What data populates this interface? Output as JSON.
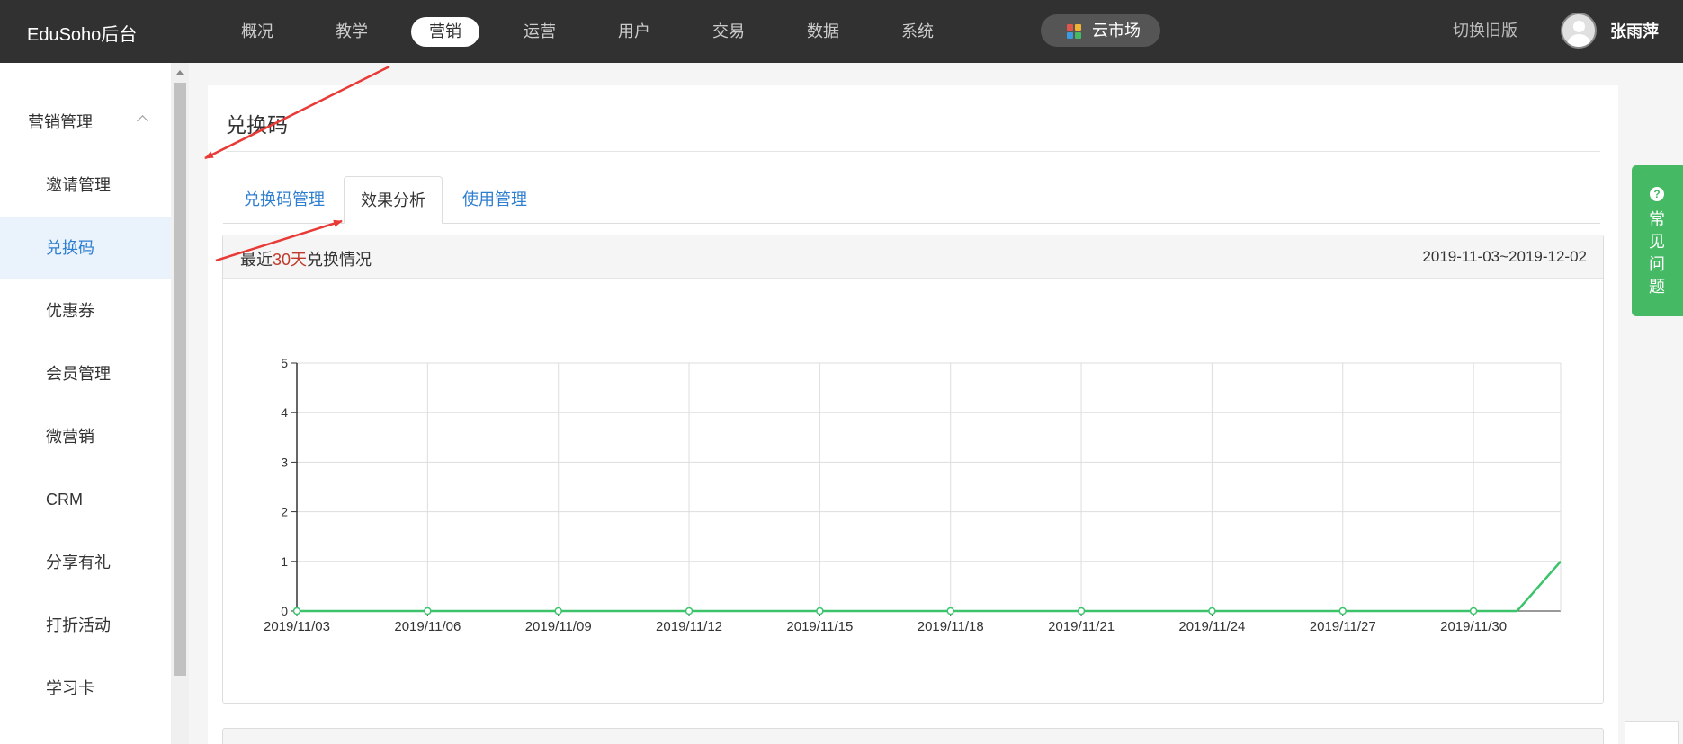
{
  "topnav": {
    "brand": "EduSoho后台",
    "items": [
      "概况",
      "教学",
      "营销",
      "运营",
      "用户",
      "交易",
      "数据",
      "系统"
    ],
    "active_index": 2,
    "cloud_market": "云市场",
    "switch_old": "切换旧版",
    "username": "张雨萍"
  },
  "sidebar": {
    "group_label": "营销管理",
    "items": [
      "邀请管理",
      "兑换码",
      "优惠券",
      "会员管理",
      "微营销",
      "CRM",
      "分享有礼",
      "打折活动",
      "学习卡"
    ],
    "active_index": 1
  },
  "main": {
    "title": "兑换码",
    "tabs": [
      "兑换码管理",
      "效果分析",
      "使用管理"
    ],
    "active_tab": 1,
    "card": {
      "title_prefix": "最近",
      "title_highlight": "30天",
      "title_suffix": "兑换情况",
      "date_range": "2019-11-03~2019-12-02"
    }
  },
  "help": {
    "icon": "?",
    "label": "常见问题"
  },
  "colors": {
    "topbar": "#313131",
    "accent_blue": "#2f7fd0",
    "line_green": "#3cc36c",
    "help_green": "#46b965",
    "highlight_red": "#c0392b",
    "annotation_red": "#e83a36"
  },
  "icons": {
    "cloud_market": "grid-icon",
    "avatar": "user-avatar-icon",
    "sidebar_group": "chevron-up-icon",
    "help": "question-circle-icon"
  },
  "chart_data": {
    "type": "line",
    "x": [
      "2019/11/03",
      "2019/11/04",
      "2019/11/05",
      "2019/11/06",
      "2019/11/07",
      "2019/11/08",
      "2019/11/09",
      "2019/11/10",
      "2019/11/11",
      "2019/11/12",
      "2019/11/13",
      "2019/11/14",
      "2019/11/15",
      "2019/11/16",
      "2019/11/17",
      "2019/11/18",
      "2019/11/19",
      "2019/11/20",
      "2019/11/21",
      "2019/11/22",
      "2019/11/23",
      "2019/11/24",
      "2019/11/25",
      "2019/11/26",
      "2019/11/27",
      "2019/11/28",
      "2019/11/29",
      "2019/11/30",
      "2019/12/01",
      "2019/12/02"
    ],
    "values": [
      0,
      0,
      0,
      0,
      0,
      0,
      0,
      0,
      0,
      0,
      0,
      0,
      0,
      0,
      0,
      0,
      0,
      0,
      0,
      0,
      0,
      0,
      0,
      0,
      0,
      0,
      0,
      0,
      0,
      1
    ],
    "ylim": [
      0,
      5
    ],
    "yticks": [
      0,
      1,
      2,
      3,
      4,
      5
    ],
    "xtick_labels": [
      "2019/11/03",
      "2019/11/06",
      "2019/11/09",
      "2019/11/12",
      "2019/11/15",
      "2019/11/18",
      "2019/11/21",
      "2019/11/24",
      "2019/11/27",
      "2019/11/30"
    ],
    "grid": true,
    "title": "",
    "xlabel": "",
    "ylabel": ""
  }
}
